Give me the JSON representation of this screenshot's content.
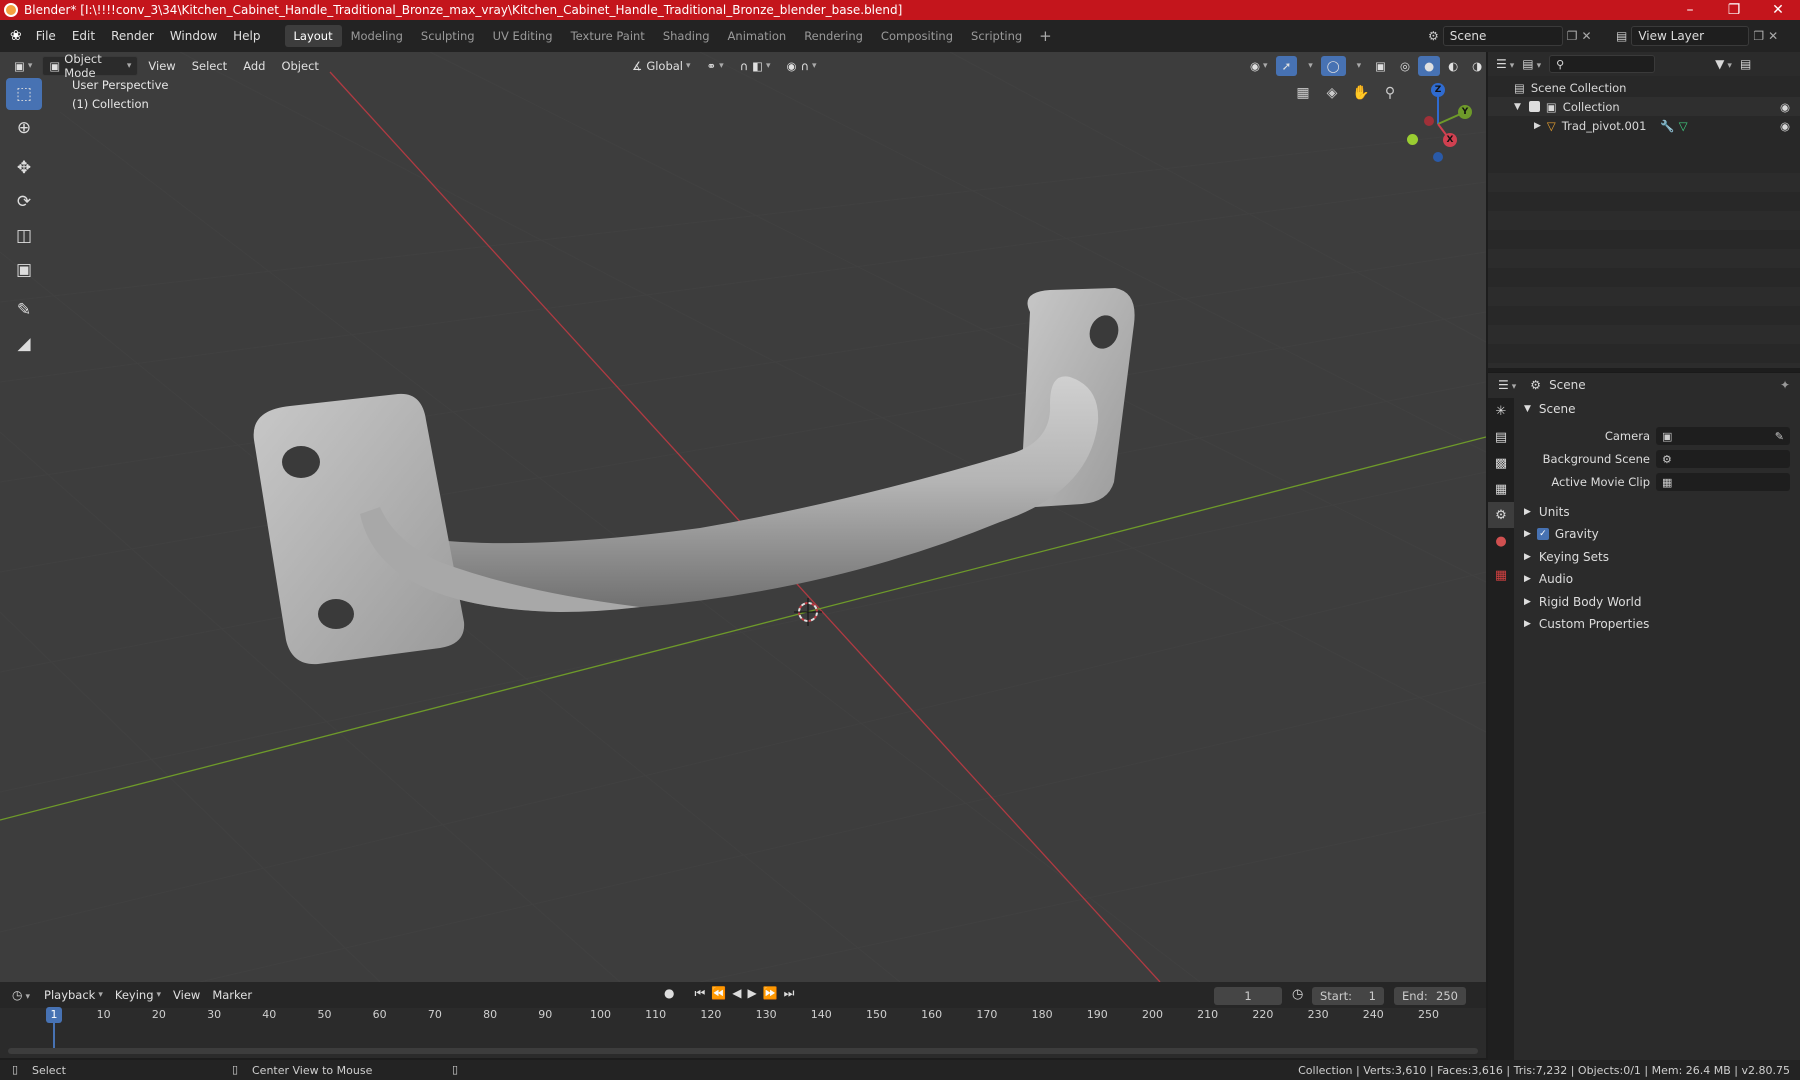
{
  "titlebar": {
    "title": "Blender* [I:\\!!!!conv_3\\34\\Kitchen_Cabinet_Handle_Traditional_Bronze_max_vray\\Kitchen_Cabinet_Handle_Traditional_Bronze_blender_base.blend]"
  },
  "menu": {
    "items": [
      "File",
      "Edit",
      "Render",
      "Window",
      "Help"
    ]
  },
  "workspaces": [
    "Layout",
    "Modeling",
    "Sculpting",
    "UV Editing",
    "Texture Paint",
    "Shading",
    "Animation",
    "Rendering",
    "Compositing",
    "Scripting"
  ],
  "active_workspace": "Layout",
  "scene_selector": "Scene",
  "view_layer_selector": "View Layer",
  "viewport": {
    "mode": "Object Mode",
    "menus": [
      "View",
      "Select",
      "Add",
      "Object"
    ],
    "orientation": "Global",
    "overlay_title": "User Perspective",
    "overlay_subtitle": "(1) Collection",
    "gizmo_axes": [
      "Z",
      "Y",
      "X"
    ]
  },
  "outliner": {
    "root": "Scene Collection",
    "collection": "Collection",
    "object": "Trad_pivot.001"
  },
  "properties": {
    "header": "Scene",
    "panel": "Scene",
    "fields": [
      {
        "label": "Camera",
        "value": ""
      },
      {
        "label": "Background Scene",
        "value": ""
      },
      {
        "label": "Active Movie Clip",
        "value": ""
      }
    ],
    "sections": [
      "Units",
      "Gravity",
      "Keying Sets",
      "Audio",
      "Rigid Body World",
      "Custom Properties"
    ],
    "gravity_checked": true
  },
  "timeline": {
    "menus": [
      "Playback",
      "Keying",
      "View",
      "Marker"
    ],
    "current_frame": "1",
    "start_label": "Start:",
    "start": "1",
    "end_label": "End:",
    "end": "250",
    "ticks": [
      "1",
      "10",
      "20",
      "30",
      "40",
      "50",
      "60",
      "70",
      "80",
      "90",
      "100",
      "110",
      "120",
      "130",
      "140",
      "150",
      "160",
      "170",
      "180",
      "190",
      "200",
      "210",
      "220",
      "230",
      "240",
      "250"
    ]
  },
  "statusbar": {
    "select": "Select",
    "center": "Center View to Mouse",
    "stats": "Collection | Verts:3,610 | Faces:3,616 | Tris:7,232 | Objects:0/1 | Mem: 26.4 MB | v2.80.75"
  },
  "colors": {
    "accent": "#4772b3",
    "titlebar": "#c4151c",
    "x_axis": "#c03c44",
    "y_axis": "#6e9a2a"
  }
}
